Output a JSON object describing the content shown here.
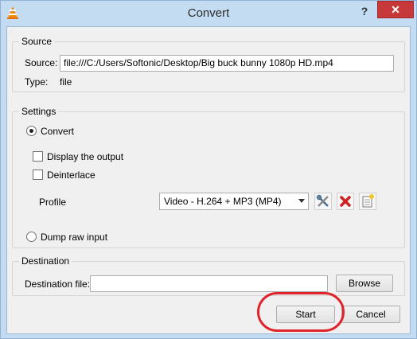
{
  "window": {
    "title": "Convert",
    "help_label": "?",
    "close_label": "✕"
  },
  "source": {
    "group_title": "Source",
    "source_label": "Source:",
    "source_value": "file:///C:/Users/Softonic/Desktop/Big buck bunny 1080p HD.mp4",
    "type_label": "Type:",
    "type_value": "file"
  },
  "settings": {
    "group_title": "Settings",
    "convert_label": "Convert",
    "display_output_label": "Display the output",
    "deinterlace_label": "Deinterlace",
    "profile_label": "Profile",
    "profile_selected": "Video - H.264 + MP3 (MP4)",
    "dump_raw_label": "Dump raw input",
    "convert_checked": true,
    "dump_raw_checked": false,
    "display_output_checked": false,
    "deinterlace_checked": false
  },
  "destination": {
    "group_title": "Destination",
    "file_label": "Destination file:",
    "file_value": "",
    "browse_label": "Browse"
  },
  "actions": {
    "start_label": "Start",
    "cancel_label": "Cancel"
  },
  "colors": {
    "titlebar": "#c3dcf2",
    "close": "#c7383a",
    "highlight_ring": "#e0242b",
    "delete_icon": "#d21f1f"
  }
}
